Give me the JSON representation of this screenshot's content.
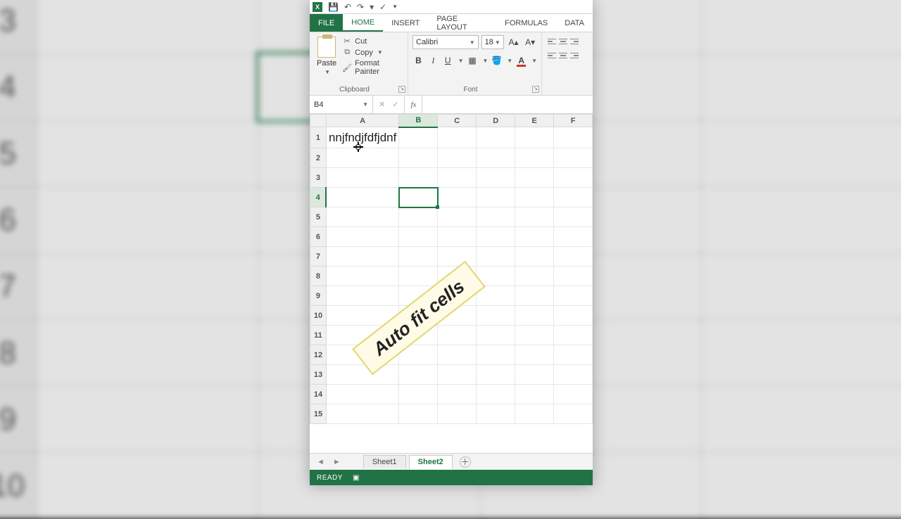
{
  "qat": {
    "app_letter": "X"
  },
  "tabs": {
    "file": "FILE",
    "home": "HOME",
    "insert": "INSERT",
    "page_layout": "PAGE LAYOUT",
    "formulas": "FORMULAS",
    "data": "DATA"
  },
  "ribbon": {
    "clipboard": {
      "paste": "Paste",
      "cut": "Cut",
      "copy": "Copy",
      "format_painter": "Format Painter",
      "group_label": "Clipboard"
    },
    "font": {
      "name": "Calibri",
      "size": "18",
      "bold": "B",
      "italic": "I",
      "underline": "U",
      "fontcolor": "A",
      "group_label": "Font"
    }
  },
  "namebox": {
    "ref": "B4"
  },
  "formula_bar": {
    "fx": "fx",
    "value": ""
  },
  "columns": [
    "A",
    "B",
    "C",
    "D",
    "E",
    "F"
  ],
  "rows": [
    "1",
    "2",
    "3",
    "4",
    "5",
    "6",
    "7",
    "8",
    "9",
    "10",
    "11",
    "12",
    "13",
    "14",
    "15"
  ],
  "cells": {
    "A1": "nnjfndjfdfjdnf"
  },
  "selected_cell": "B4",
  "callout": "Auto fit cells",
  "sheet_tabs": {
    "sheet1": "Sheet1",
    "sheet2": "Sheet2"
  },
  "status": {
    "ready": "READY"
  },
  "bg_rows": [
    "3",
    "4",
    "5",
    "6",
    "7",
    "8",
    "9",
    "10"
  ]
}
